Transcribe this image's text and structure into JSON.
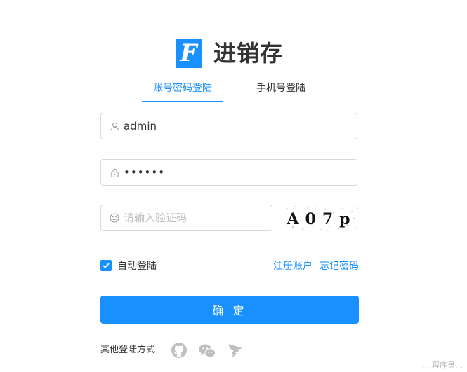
{
  "app": {
    "title": "进销存",
    "logo_letter": "F",
    "brand_color": "#1890ff"
  },
  "tabs": [
    {
      "label": "账号密码登陆",
      "active": true
    },
    {
      "label": "手机号登陆",
      "active": false
    }
  ],
  "form": {
    "username": {
      "value": "admin",
      "icon": "user-icon"
    },
    "password": {
      "value": "••••••",
      "icon": "lock-icon"
    },
    "captcha_input": {
      "placeholder": "请输入验证码",
      "icon": "smile-icon"
    },
    "captcha_image_text": "A07p",
    "remember": {
      "label": "自动登陆",
      "checked": true
    },
    "register_link": "注册账户",
    "forgot_link": "忘记密码",
    "submit_label": "确 定"
  },
  "other_login": {
    "label": "其他登陆方式",
    "icons": [
      "github-icon",
      "wechat-icon",
      "dingtalk-icon"
    ]
  },
  "footer": {
    "text": "... 程序员…"
  }
}
